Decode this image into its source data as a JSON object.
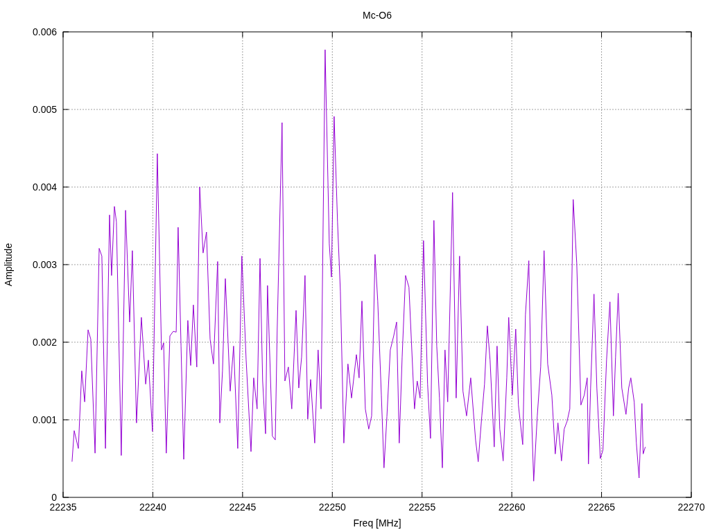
{
  "chart_data": {
    "type": "line",
    "title": "Mc-O6",
    "xlabel": "Freq [MHz]",
    "ylabel": "Amplitude",
    "grid": true,
    "xlim": [
      22235,
      22270
    ],
    "ylim": [
      0,
      0.006
    ],
    "xticks": [
      22235,
      22240,
      22245,
      22250,
      22255,
      22260,
      22265,
      22270
    ],
    "yticks": [
      0,
      0.001,
      0.002,
      0.003,
      0.004,
      0.005,
      0.006
    ],
    "x": [
      22235.5,
      22235.62,
      22235.85,
      22236.04,
      22236.2,
      22236.39,
      22236.54,
      22236.78,
      22237.01,
      22237.16,
      22237.36,
      22237.59,
      22237.7,
      22237.86,
      22237.97,
      22238.24,
      22238.48,
      22238.71,
      22238.86,
      22239.09,
      22239.36,
      22239.6,
      22239.75,
      22239.98,
      22240.25,
      22240.48,
      22240.6,
      22240.75,
      22240.95,
      22241.14,
      22241.3,
      22241.41,
      22241.57,
      22241.72,
      22241.95,
      22242.11,
      22242.26,
      22242.45,
      22242.61,
      22242.8,
      22242.99,
      22243.19,
      22243.38,
      22243.61,
      22243.73,
      22243.88,
      22244.04,
      22244.31,
      22244.5,
      22244.73,
      22244.96,
      22245.2,
      22245.47,
      22245.62,
      22245.81,
      22245.97,
      22246.12,
      22246.28,
      22246.39,
      22246.66,
      22246.82,
      22246.93,
      22247.2,
      22247.36,
      22247.55,
      22247.74,
      22247.98,
      22248.13,
      22248.29,
      22248.48,
      22248.63,
      22248.79,
      22249.02,
      22249.21,
      22249.37,
      22249.6,
      22249.83,
      22249.95,
      22250.1,
      22250.29,
      22250.45,
      22250.64,
      22250.87,
      22251.07,
      22251.34,
      22251.49,
      22251.65,
      22251.84,
      22252.03,
      22252.19,
      22252.38,
      22252.53,
      22252.73,
      22252.88,
      22253.04,
      22253.23,
      22253.42,
      22253.58,
      22253.73,
      22253.89,
      22254.08,
      22254.27,
      22254.58,
      22254.73,
      22254.89,
      22255.08,
      22255.31,
      22255.47,
      22255.66,
      22255.82,
      22255.97,
      22256.13,
      22256.28,
      22256.43,
      22256.7,
      22256.9,
      22257.09,
      22257.28,
      22257.48,
      22257.71,
      22257.98,
      22258.13,
      22258.33,
      22258.48,
      22258.64,
      22258.79,
      22259.02,
      22259.18,
      22259.33,
      22259.52,
      22259.72,
      22259.83,
      22260.03,
      22260.22,
      22260.37,
      22260.61,
      22260.76,
      22260.95,
      22261.11,
      22261.22,
      22261.42,
      22261.61,
      22261.8,
      22262.0,
      22262.23,
      22262.42,
      22262.57,
      22262.77,
      22262.92,
      22263.08,
      22263.23,
      22263.42,
      22263.62,
      22263.85,
      22264.04,
      22264.2,
      22264.27,
      22264.39,
      22264.58,
      22264.74,
      22264.93,
      22265.08,
      22265.28,
      22265.47,
      22265.66,
      22265.78,
      22265.93,
      22266.13,
      22266.36,
      22266.51,
      22266.63,
      22266.82,
      22266.94,
      22267.09,
      22267.25,
      22267.32,
      22267.44
    ],
    "series": [
      {
        "color": "#9400d3",
        "values": [
          0.00046,
          0.00086,
          0.00063,
          0.00163,
          0.00123,
          0.00216,
          0.00204,
          0.00057,
          0.00321,
          0.00311,
          0.00063,
          0.00364,
          0.00286,
          0.00375,
          0.00355,
          0.00054,
          0.0037,
          0.00226,
          0.00318,
          0.00096,
          0.00232,
          0.00146,
          0.00177,
          0.00085,
          0.00443,
          0.0019,
          0.00199,
          0.00057,
          0.00208,
          0.00214,
          0.00213,
          0.00348,
          0.00195,
          0.00049,
          0.00228,
          0.0017,
          0.00248,
          0.00168,
          0.004,
          0.00315,
          0.00342,
          0.00204,
          0.00172,
          0.00304,
          0.00096,
          0.00163,
          0.00282,
          0.00137,
          0.00195,
          0.00063,
          0.00311,
          0.00177,
          0.00059,
          0.00154,
          0.00114,
          0.00308,
          0.0015,
          0.00082,
          0.00273,
          0.00079,
          0.00074,
          0.00217,
          0.00483,
          0.0015,
          0.00168,
          0.00114,
          0.00241,
          0.00141,
          0.00181,
          0.00286,
          0.00101,
          0.00152,
          0.0007,
          0.0019,
          0.00114,
          0.00577,
          0.00327,
          0.00284,
          0.00491,
          0.00355,
          0.00266,
          0.0007,
          0.00172,
          0.00128,
          0.00184,
          0.00154,
          0.00253,
          0.00114,
          0.00088,
          0.00105,
          0.00313,
          0.00253,
          0.00132,
          0.00038,
          0.00104,
          0.0019,
          0.00208,
          0.00226,
          0.0007,
          0.00181,
          0.00286,
          0.00271,
          0.00114,
          0.0015,
          0.00128,
          0.00331,
          0.00146,
          0.00076,
          0.00357,
          0.00195,
          0.00128,
          0.00038,
          0.0019,
          0.00123,
          0.00393,
          0.00128,
          0.00311,
          0.00137,
          0.00105,
          0.00154,
          0.00074,
          0.00046,
          0.00105,
          0.00146,
          0.00221,
          0.00177,
          0.00065,
          0.00195,
          0.00088,
          0.00047,
          0.00154,
          0.00232,
          0.00132,
          0.00217,
          0.00119,
          0.00068,
          0.00235,
          0.00305,
          0.00099,
          0.00021,
          0.00105,
          0.00168,
          0.00318,
          0.00172,
          0.00132,
          0.00056,
          0.00096,
          0.00047,
          0.00088,
          0.00098,
          0.00114,
          0.00384,
          0.00302,
          0.00119,
          0.00132,
          0.00154,
          0.00043,
          0.00141,
          0.00262,
          0.00141,
          0.0005,
          0.00061,
          0.00177,
          0.00252,
          0.00105,
          0.00181,
          0.00263,
          0.00141,
          0.00107,
          0.00141,
          0.00154,
          0.00123,
          0.0007,
          0.00025,
          0.00121,
          0.00056,
          0.00065
        ]
      }
    ]
  }
}
